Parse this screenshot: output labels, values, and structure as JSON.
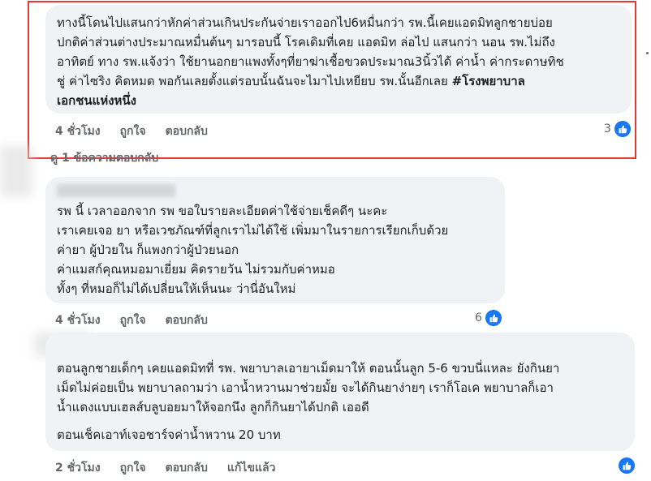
{
  "comments": [
    {
      "lines": [
        "ทางนี้โดนไปแสนกว่าหักค่าส่วนเกินประกันจ่ายเราออกไป6หมื่นกว่า รพ.นี้เคยแอดมิทลูกชายบ่อย",
        "ปกติค่าส่วนต่างประมาณหมื่นต้นๆ มารอบนี้ โรคเดิมที่เคย แอดมิท ล่อไป แสนกว่า นอน รพ.ไม่ถึง",
        "อาทิตย์ ทาง รพ.แจ้งว่า ใช้ยานอกยาแพงทั้งๆที่ยาฆ่าเชื้อขวดประมาณ3นิ้วได้ ค่าน้ำ ค่ากระดาษทิช",
        "ชู่ ค่าไซริง คิดหมด พอกันเลยตั้งแต่รอบนั้นฉันจะไมาไปเหยียบ รพ.นั้นอีกเลย "
      ],
      "hashtag_part1": "#โรงพยาบาล",
      "hashtag_part2": "เอกชนแห่งหนึ่ง",
      "time": "4 ชั่วโมง",
      "like": "ถูกใจ",
      "reply": "ตอบกลับ",
      "reaction_count": "3",
      "view_replies": "ดู 1 ข้อความตอบกลับ"
    },
    {
      "lines": [
        "รพ นี้ เวลาออกจาก รพ ขอใบรายละเอียดค่าใช้จ่ายเช็คดีๆ นะคะ",
        "เราเคยเจอ ยา หรือเวชภัณฑ์ที่ลูกเราไม่ได้ใช้ เพิ่มมาในรายการเรียกเก็บด้วย",
        "ค่ายา ผู้ป่วยใน ก็แพงกว่าผู้ป่วยนอก",
        "ค่าแมสก์คุณหมอมาเยี่ยม คิดรายวัน ไม่รวมกับค่าหมอ",
        "ทั้งๆ ที่หมอก็ไม่ได้เปลี่ยนให้เห็นนะ ว่านี่อันใหม่"
      ],
      "time": "4 ชั่วโมง",
      "like": "ถูกใจ",
      "reply": "ตอบกลับ",
      "reaction_count": "6"
    },
    {
      "lines": [
        "ตอนลูกชายเด็กๆ เคยแอดมิทที่ รพ. พยาบาลเอายาเม็ดมาให้ ตอนนั้นลูก 5-6 ขวบนี่แหละ ยังกินยา",
        "เม็ดไม่ค่อยเป็น พยาบาลถามว่า เอาน้ำหวานมาช่วยมั้ย จะได้กินยาง่ายๆ เราก็โอเค พยาบาลก็เอา",
        "น้ำแดงแบบเฮลส์บลูบอยมาให้จอกนึง ลูกก็กินยาได้ปกติ เออดี",
        "",
        "ตอนเช็คเอาท์เจอชาร์จค่าน้ำหวาน 20 บาท"
      ],
      "time": "2 ชั่วโมง",
      "like": "ถูกใจ",
      "reply": "ตอบกลับ",
      "edit": "แก้ไขแล้ว"
    }
  ],
  "colors": {
    "bubble": "#f0f2f5",
    "accent": "#1877f2",
    "highlight": "#e53935",
    "meta": "#65676b"
  }
}
